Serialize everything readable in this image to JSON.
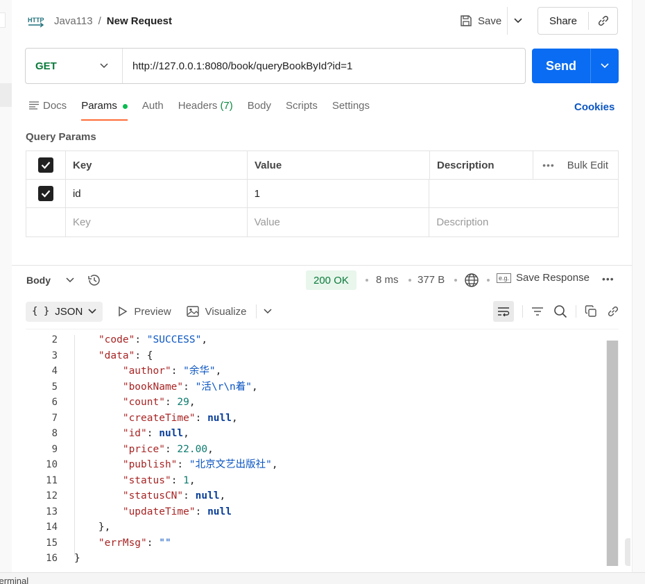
{
  "header": {
    "icon": "http-icon",
    "collection": "Java113",
    "separator": "/",
    "title": "New Request",
    "save_label": "Save",
    "share_label": "Share"
  },
  "request": {
    "method": "GET",
    "url": "http://127.0.0.1:8080/book/queryBookById?id=1",
    "send_label": "Send"
  },
  "tabs": {
    "docs": "Docs",
    "params": "Params",
    "auth": "Auth",
    "headers": "Headers",
    "headers_count": "(7)",
    "body": "Body",
    "scripts": "Scripts",
    "settings": "Settings",
    "active": "Params",
    "cookies": "Cookies"
  },
  "query_params": {
    "title": "Query Params",
    "columns": [
      "Key",
      "Value",
      "Description"
    ],
    "bulk_edit": "Bulk Edit",
    "rows": [
      {
        "checked": true,
        "key": "id",
        "value": "1",
        "description": ""
      }
    ],
    "placeholders": {
      "key": "Key",
      "value": "Value",
      "description": "Description"
    }
  },
  "response": {
    "body_label": "Body",
    "status": "200 OK",
    "time": "8 ms",
    "size": "377 B",
    "save_response": "Save Response",
    "format": "JSON",
    "preview": "Preview",
    "visualize": "Visualize",
    "line_numbers": [
      "2",
      "3",
      "4",
      "5",
      "6",
      "7",
      "8",
      "9",
      "10",
      "11",
      "12",
      "13",
      "14",
      "15",
      "16"
    ]
  },
  "colors": {
    "send": "#0a6cf2",
    "method_get": "#0b7a3b",
    "active_tab": "#ff6c37",
    "status_ok_bg": "#e8f6ec"
  },
  "footer": {
    "label": "Terminal"
  }
}
